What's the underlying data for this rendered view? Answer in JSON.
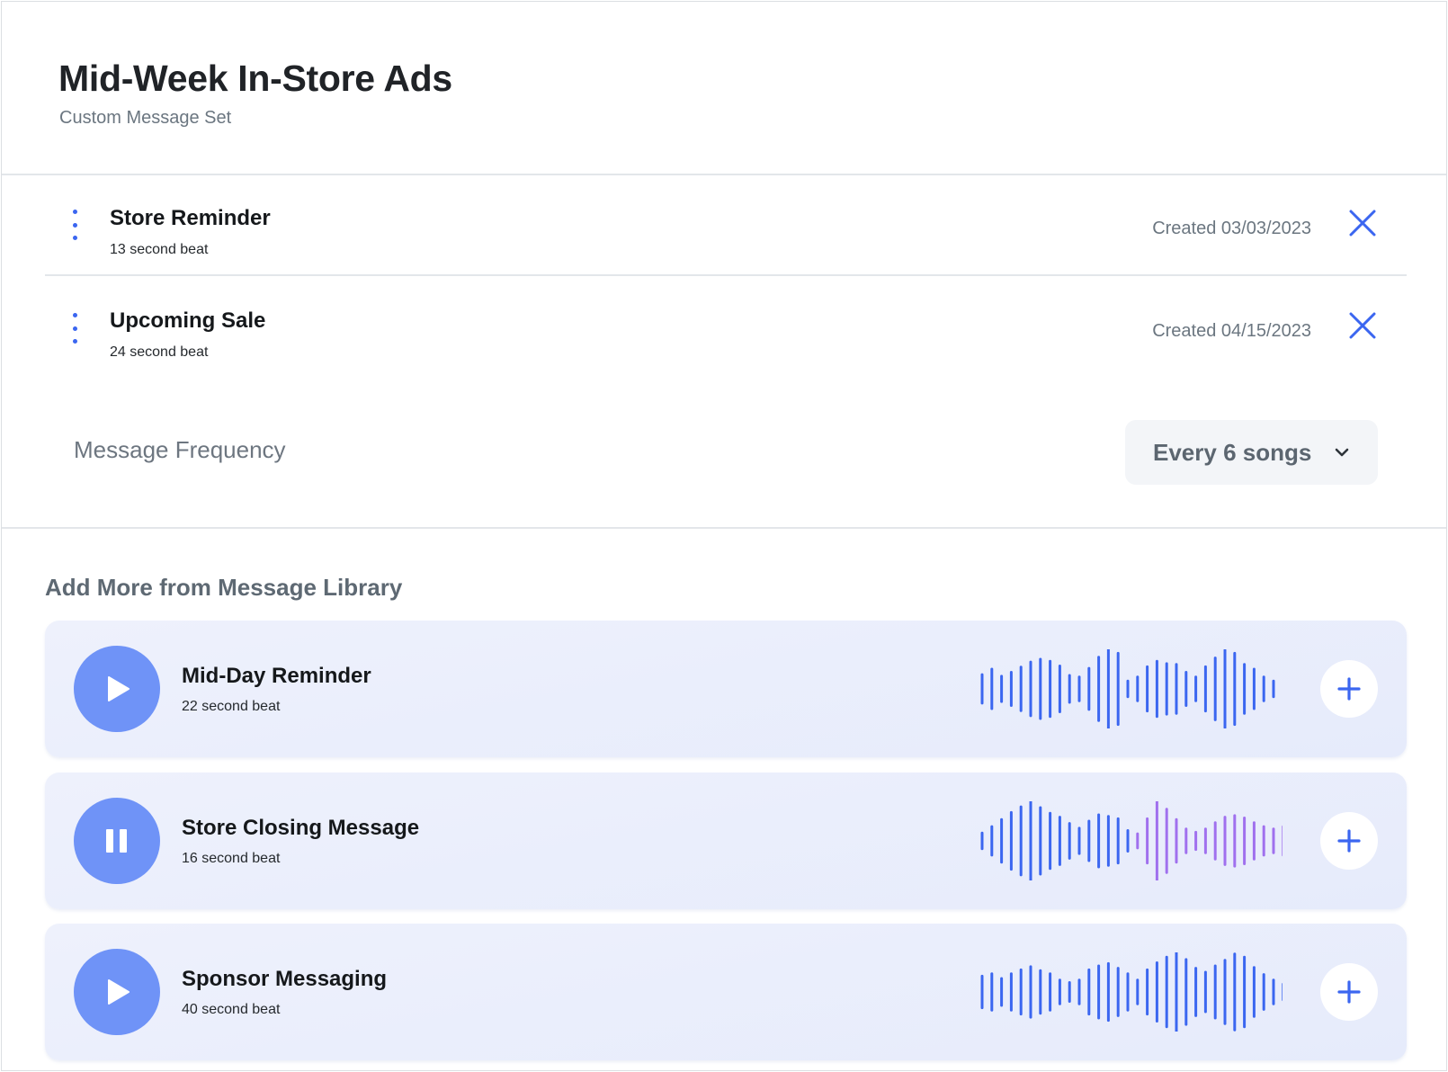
{
  "header": {
    "title": "Mid-Week In-Store Ads",
    "subtitle": "Custom Message Set"
  },
  "message_set": {
    "items": [
      {
        "name": "Store Reminder",
        "duration": "13 second beat",
        "created": "Created 03/03/2023",
        "menu_icon": "kebab-menu-icon",
        "remove_icon": "close-icon"
      },
      {
        "name": "Upcoming Sale",
        "duration": "24 second beat",
        "created": "Created 04/15/2023",
        "menu_icon": "kebab-menu-icon",
        "remove_icon": "close-icon"
      }
    ],
    "frequency": {
      "label": "Message Frequency",
      "selected": "Every 6 songs",
      "icon": "chevron-down-icon"
    }
  },
  "library": {
    "heading": "Add More from Message Library",
    "items": [
      {
        "name": "Mid-Day Reminder",
        "duration": "22 second beat",
        "state": "paused",
        "control_icon": "play-icon",
        "add_icon": "plus-icon",
        "waveform": [
          0.36,
          0.5,
          0.32,
          0.42,
          0.55,
          0.68,
          0.75,
          0.7,
          0.58,
          0.34,
          0.3,
          0.52,
          0.8,
          1.0,
          0.9,
          0.2,
          0.3,
          0.56,
          0.7,
          0.64,
          0.62,
          0.42,
          0.3,
          0.56,
          0.78,
          0.98,
          0.9,
          0.62,
          0.5,
          0.3,
          0.2
        ],
        "played_fraction": 0
      },
      {
        "name": "Store Closing Message",
        "duration": "16 second beat",
        "state": "playing",
        "control_icon": "pause-icon",
        "add_icon": "plus-icon",
        "waveform": [
          0.2,
          0.36,
          0.54,
          0.72,
          0.86,
          1.0,
          0.84,
          0.7,
          0.6,
          0.44,
          0.32,
          0.5,
          0.66,
          0.62,
          0.56,
          0.26,
          0.18,
          0.56,
          1.0,
          0.8,
          0.54,
          0.3,
          0.22,
          0.3,
          0.46,
          0.6,
          0.64,
          0.58,
          0.46,
          0.36,
          0.3,
          0.36
        ],
        "played_fraction": 0.5
      },
      {
        "name": "Sponsor Messaging",
        "duration": "40 second beat",
        "state": "paused",
        "control_icon": "play-icon",
        "add_icon": "plus-icon",
        "waveform": [
          0.4,
          0.46,
          0.34,
          0.46,
          0.56,
          0.64,
          0.54,
          0.46,
          0.3,
          0.24,
          0.3,
          0.56,
          0.66,
          0.72,
          0.6,
          0.46,
          0.3,
          0.56,
          0.74,
          0.88,
          1.0,
          0.82,
          0.6,
          0.5,
          0.66,
          0.8,
          0.96,
          0.88,
          0.62,
          0.44,
          0.3,
          0.2
        ],
        "played_fraction": 0
      }
    ]
  },
  "colors": {
    "accent": "#3b66f0",
    "play_button": "#6f93f7",
    "wave_played": "#3b66f0",
    "wave_unplayed": "#a070ee"
  }
}
